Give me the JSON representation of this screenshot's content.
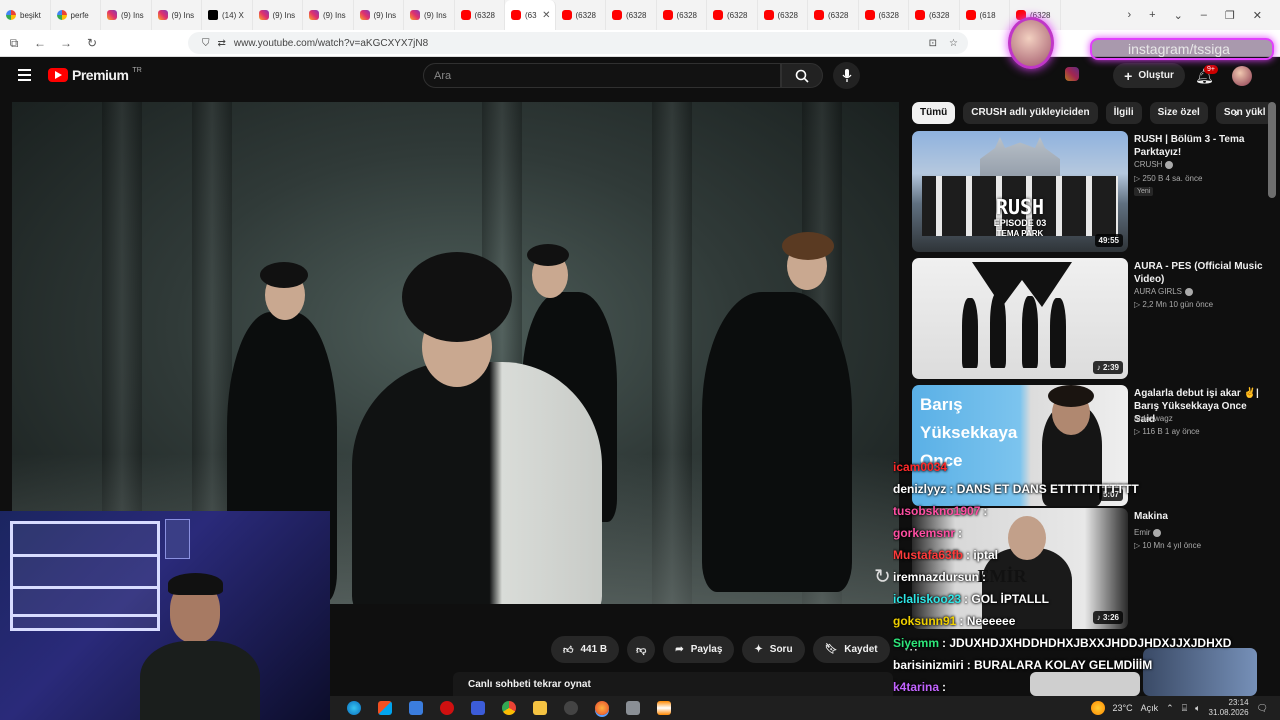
{
  "browser": {
    "tabs": [
      {
        "label": "beşikt",
        "favicon": "google-favicon",
        "active": false
      },
      {
        "label": "perfe",
        "favicon": "google-favicon",
        "active": false
      },
      {
        "label": "(9) Ins",
        "favicon": "instagram-favicon",
        "active": false
      },
      {
        "label": "(9) Ins",
        "favicon": "instagram-favicon",
        "active": false
      },
      {
        "label": "(14) X",
        "favicon": "x-favicon",
        "active": false
      },
      {
        "label": "(9) Ins",
        "favicon": "instagram-favicon",
        "active": false
      },
      {
        "label": "(9) Ins",
        "favicon": "instagram-favicon",
        "active": false
      },
      {
        "label": "(9) Ins",
        "favicon": "instagram-favicon",
        "active": false
      },
      {
        "label": "(9) Ins",
        "favicon": "instagram-favicon",
        "active": false
      },
      {
        "label": "(6328",
        "favicon": "youtube-favicon",
        "active": false
      },
      {
        "label": "(63",
        "favicon": "youtube-favicon",
        "active": true
      },
      {
        "label": "(6328",
        "favicon": "youtube-favicon",
        "active": false
      },
      {
        "label": "(6328",
        "favicon": "youtube-favicon",
        "active": false
      },
      {
        "label": "(6328",
        "favicon": "youtube-favicon",
        "active": false
      },
      {
        "label": "(6328",
        "favicon": "youtube-favicon",
        "active": false
      },
      {
        "label": "(6328",
        "favicon": "youtube-favicon",
        "active": false
      },
      {
        "label": "(6328",
        "favicon": "youtube-favicon",
        "active": false
      },
      {
        "label": "(6328",
        "favicon": "youtube-favicon",
        "active": false
      },
      {
        "label": "(6328",
        "favicon": "youtube-favicon",
        "active": false
      },
      {
        "label": "(618",
        "favicon": "youtube-favicon",
        "active": false
      },
      {
        "label": "(6328",
        "favicon": "youtube-favicon",
        "active": false
      }
    ],
    "url": "www.youtube.com/watch?v=aKGCXYX7jN8"
  },
  "youtube": {
    "logo_text": "Premium",
    "country": "TR",
    "search_placeholder": "Ara",
    "create_label": "Oluştur",
    "notif_count": "9+"
  },
  "video_actions": {
    "like_count": "441 B",
    "share_label": "Paylaş",
    "ask_label": "Soru",
    "save_label": "Kaydet"
  },
  "live_chat_replay": "Canlı sohbeti tekrar oynat",
  "chips": [
    "Tümü",
    "CRUSH adlı yükleyiciden",
    "İlgili",
    "Size özel",
    "Son yükl"
  ],
  "recommendations": [
    {
      "title": "RUSH | Bölüm 3 - Tema Parktayız!",
      "channel": "CRUSH",
      "meta": "▷ 250 B   4 sa. önce",
      "new_badge": "Yeni",
      "duration": "49:55",
      "thumb_text": "RUSH",
      "thumb_sub": "EPISODE 03",
      "thumb_sub2": "TEMA PARK"
    },
    {
      "title": "AURA - PES (Official Music Video)",
      "channel": "AURA GIRLS",
      "meta": "▷ 2,2 Mn   10 gün önce",
      "duration": "2:39"
    },
    {
      "title": "Agalarla debut işi akar ✌️| Barış Yüksekkaya Once Said",
      "channel": "ardaswagz",
      "meta": "▷ 116 B   1 ay önce",
      "duration": "5:07",
      "thumb_text": "Barış Yüksekkaya Once"
    },
    {
      "title": "Makina",
      "channel": "Emir",
      "meta": "▷ 10 Mn   4 yıl önce",
      "duration": "3:26",
      "thumb_text": "EMİR"
    }
  ],
  "chat": [
    {
      "user": "icam0034",
      "text": "",
      "color": "#ff2a2a"
    },
    {
      "user": "denizlyyz",
      "text": ": DANS ET DANS ETTTTTTTTTTT",
      "color": "#ffffff"
    },
    {
      "user": "tusobskno1907",
      "text": ":",
      "color": "#ff4fa3"
    },
    {
      "user": "gorkemsnr",
      "text": ":",
      "color": "#ff4fa3"
    },
    {
      "user": "Mustafa63fb",
      "text": ": iptal",
      "color": "#ff3b3b"
    },
    {
      "user": "iremnazdursun",
      "text": ":",
      "color": "#ffffff"
    },
    {
      "user": "iclaliskoo23",
      "text": ": GOL İPTALLL",
      "color": "#2ee6e6"
    },
    {
      "user": "goksunn91",
      "text": ": Neeeeee",
      "color": "#f0d000"
    },
    {
      "user": "Siyemm",
      "text": ": JDUXHDJXHDDHDHXJBXXJHDDJHDXJJXJDHXD",
      "color": "#2ee67a"
    },
    {
      "user": "barisinizmiri",
      "text": ": BURALARA KOLAY GELMDİİİM",
      "color": "#ffffff"
    },
    {
      "user": "k4tarina",
      "text": ":",
      "color": "#c264ff"
    }
  ],
  "overlay": {
    "social_handle": "instagram/tssiga"
  },
  "taskbar": {
    "temperature": "23°C",
    "weather": "Açık",
    "time": "23:14",
    "date": "31.08.2026"
  },
  "colors": {
    "accent_red": "#ff0000",
    "overlay_purple": "#e040fb"
  }
}
